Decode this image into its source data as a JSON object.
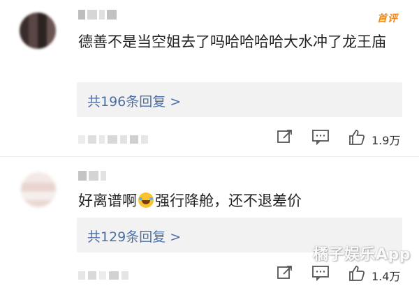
{
  "comments": [
    {
      "badge": "首评",
      "text": "德善不是当空姐去了吗哈哈哈哈大水冲了龙王庙",
      "replies_label": "共196条回复 >",
      "likes": "1.9万"
    },
    {
      "text_before": "好离谱啊",
      "emoji": "laugh-cry-emoji",
      "text_after": "强行降舱，还不退差价",
      "replies_label": "共129条回复 >",
      "likes": "1.4万"
    }
  ],
  "watermark": "橘子娱乐App",
  "colors": {
    "link": "#4b6fa5",
    "badge": "#f08a17",
    "text": "#222222",
    "reply_bg": "#f2f2f2"
  },
  "icons": {
    "share": "share-icon",
    "comment": "comment-icon",
    "like": "thumbs-up-icon"
  }
}
